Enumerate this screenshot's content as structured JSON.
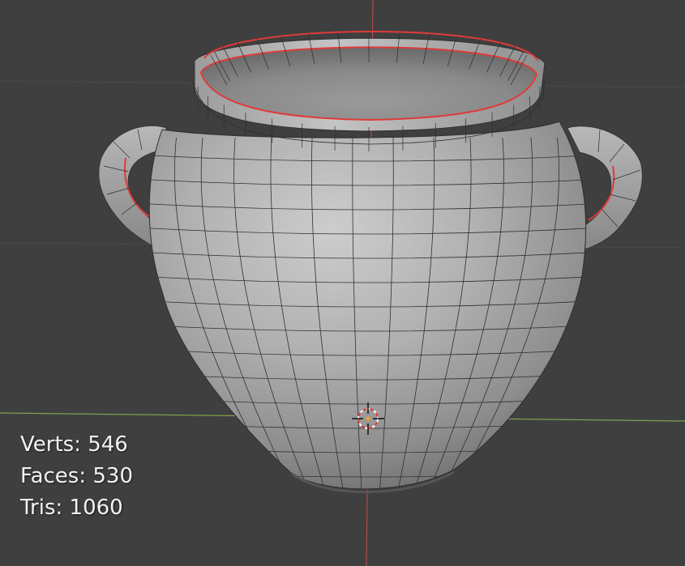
{
  "viewport": {
    "background": "#3f3f3f",
    "grid_line_color": "#4a4a4a",
    "x_axis_color": "#7fa04a",
    "z_axis_color": "#b04a4a",
    "mesh_base_color": "#a4a4a4",
    "mesh_highlight_color": "#c8c8c8",
    "mesh_shadow_color": "#6a6a6a",
    "wire_color": "#2f2f2f",
    "boundary_edge_color": "#e03a3a",
    "origin_icon": "3d-cursor-icon"
  },
  "stats": {
    "verts_label": "Verts:",
    "verts_value": "546",
    "faces_label": "Faces:",
    "faces_value": "530",
    "tris_label": "Tris:",
    "tris_value": "1060"
  }
}
